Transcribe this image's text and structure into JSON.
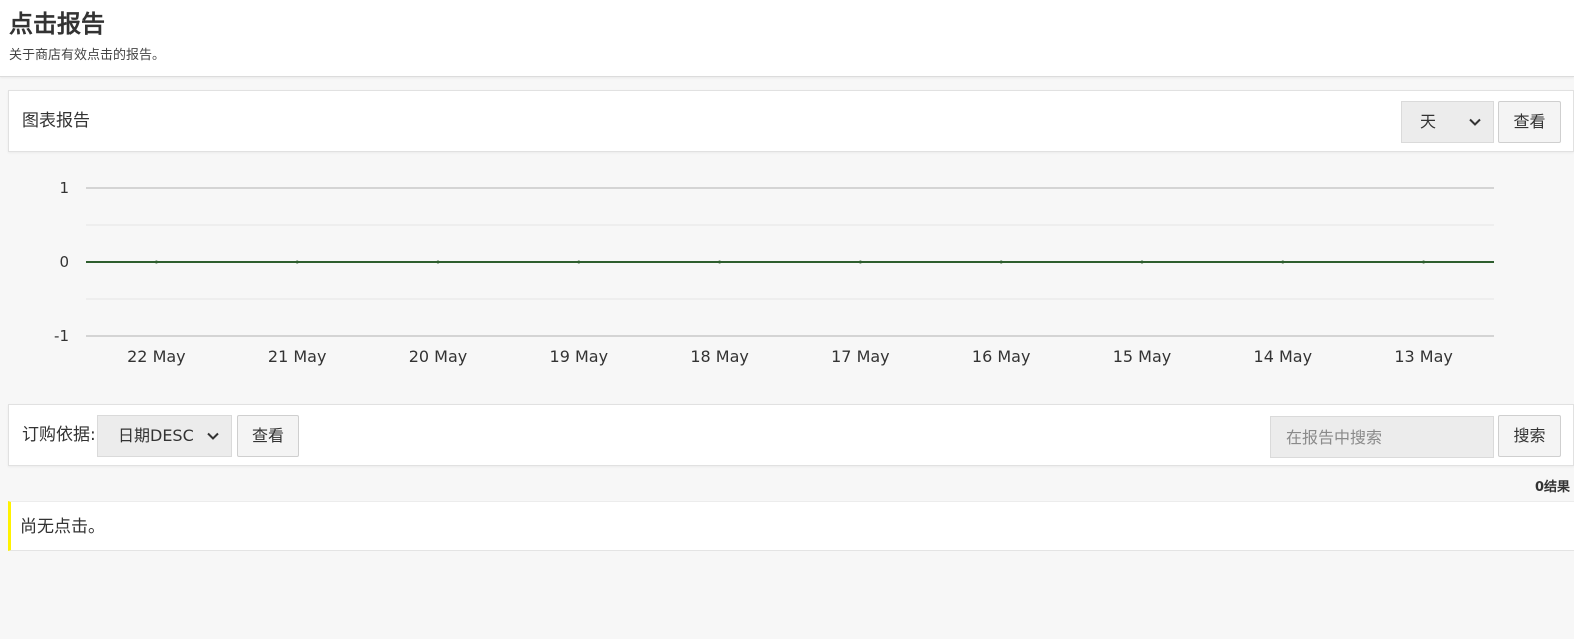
{
  "header": {
    "title": "点击报告",
    "subtitle": "关于商店有效点击的报告。"
  },
  "chart_panel": {
    "title": "图表报告",
    "period_select": {
      "selected": "天"
    },
    "view_button": "查看"
  },
  "chart_data": {
    "type": "line",
    "categories": [
      "22 May",
      "21 May",
      "20 May",
      "19 May",
      "18 May",
      "17 May",
      "16 May",
      "15 May",
      "14 May",
      "13 May"
    ],
    "series": [
      {
        "values": [
          0,
          0,
          0,
          0,
          0,
          0,
          0,
          0,
          0,
          0
        ]
      }
    ],
    "y_ticks": [
      "1",
      "0",
      "-1"
    ],
    "ylim": [
      -1,
      1
    ],
    "grid": true,
    "colors": {
      "line": "#2e5e2e",
      "grid": "#e6e6e6",
      "axis": "#c8c8c8"
    }
  },
  "toolbar": {
    "sort_label": "订购依据:",
    "sort_select": {
      "selected": "日期DESC"
    },
    "view_button": "查看",
    "search_placeholder": "在报告中搜索",
    "search_button": "搜索"
  },
  "results": {
    "count_text": "0结果",
    "empty_message": "尚无点击。"
  },
  "colors": {
    "notice_accent": "#fff200",
    "background": "#f7f7f7"
  }
}
